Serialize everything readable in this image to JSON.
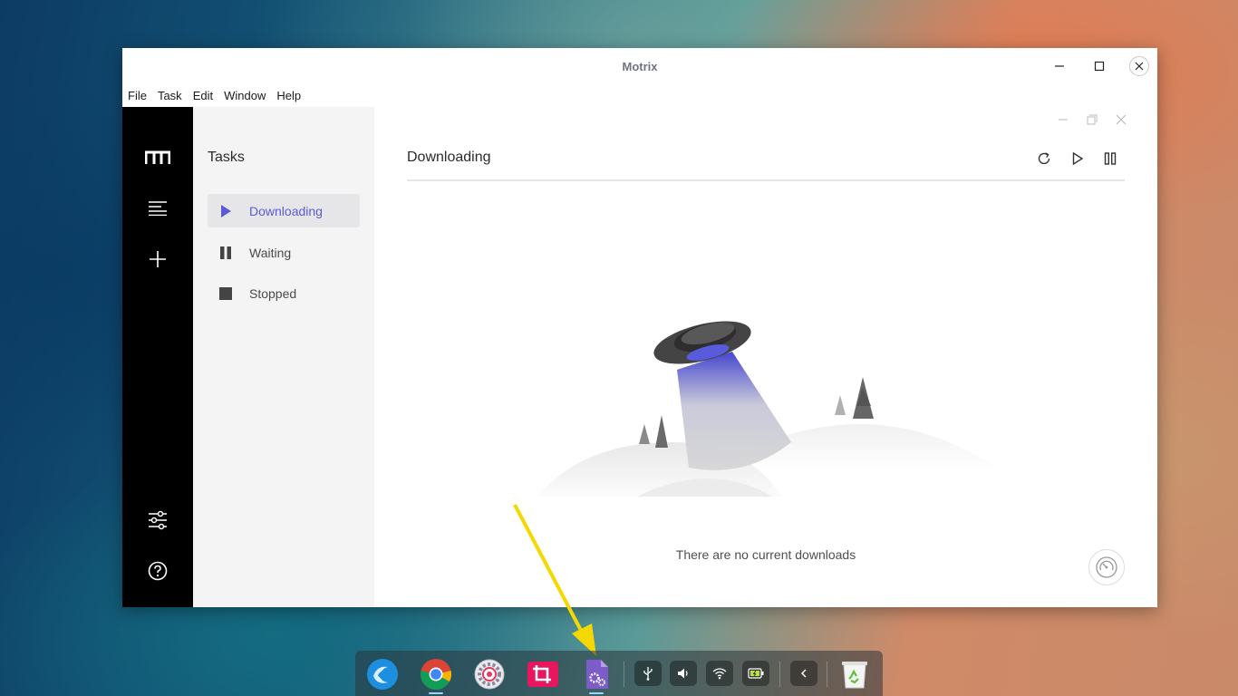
{
  "window": {
    "title": "Motrix",
    "controls": {
      "minimize_icon": "minimize-icon",
      "maximize_icon": "maximize-icon",
      "close_icon": "close-icon"
    }
  },
  "menubar": {
    "items": [
      "File",
      "Task",
      "Edit",
      "Window",
      "Help"
    ]
  },
  "sidebar": {
    "logo_icon": "motrix-logo-icon",
    "buttons": [
      "task-list-icon",
      "add-task-icon",
      "preferences-icon",
      "help-icon"
    ]
  },
  "tasks_panel": {
    "title": "Tasks",
    "items": [
      {
        "label": "Downloading",
        "icon": "play-icon",
        "active": true
      },
      {
        "label": "Waiting",
        "icon": "pause-icon",
        "active": false
      },
      {
        "label": "Stopped",
        "icon": "stop-icon",
        "active": false
      }
    ]
  },
  "main": {
    "title": "Downloading",
    "actions": [
      "refresh-icon",
      "resume-all-icon",
      "pause-all-icon"
    ],
    "empty_message": "There are no current downloads",
    "speedometer_icon": "speedometer-icon"
  },
  "dock": {
    "apps": [
      "deepin-launcher-icon",
      "chrome-icon",
      "settings-icon",
      "screenshot-icon",
      "motrix-app-icon"
    ],
    "tray": [
      "usb-icon",
      "volume-icon",
      "wifi-icon",
      "battery-icon",
      "collapse-icon"
    ],
    "trash_icon": "trash-icon"
  },
  "colors": {
    "accent": "#5b5bd6",
    "sidebar_bg": "#000000",
    "panel_bg": "#f4f4f5",
    "annotation_arrow": "#f5d800"
  }
}
